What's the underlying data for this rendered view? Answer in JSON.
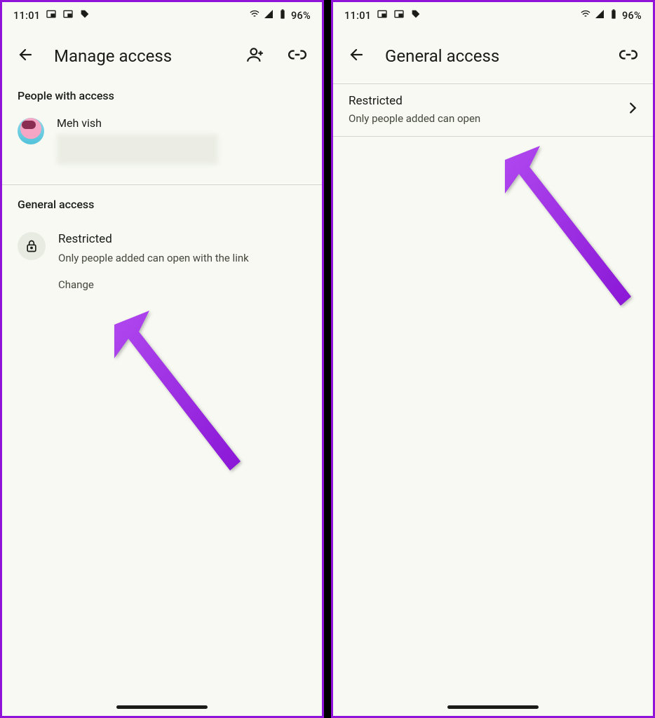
{
  "status": {
    "time": "11:01",
    "battery": "96%"
  },
  "left": {
    "title": "Manage access",
    "people_header": "People with access",
    "person_name": "Meh vish",
    "general_header": "General access",
    "restricted_title": "Restricted",
    "restricted_sub": "Only people added can open with the link",
    "change": "Change"
  },
  "right": {
    "title": "General access",
    "row_title": "Restricted",
    "row_sub": "Only people added can open"
  }
}
